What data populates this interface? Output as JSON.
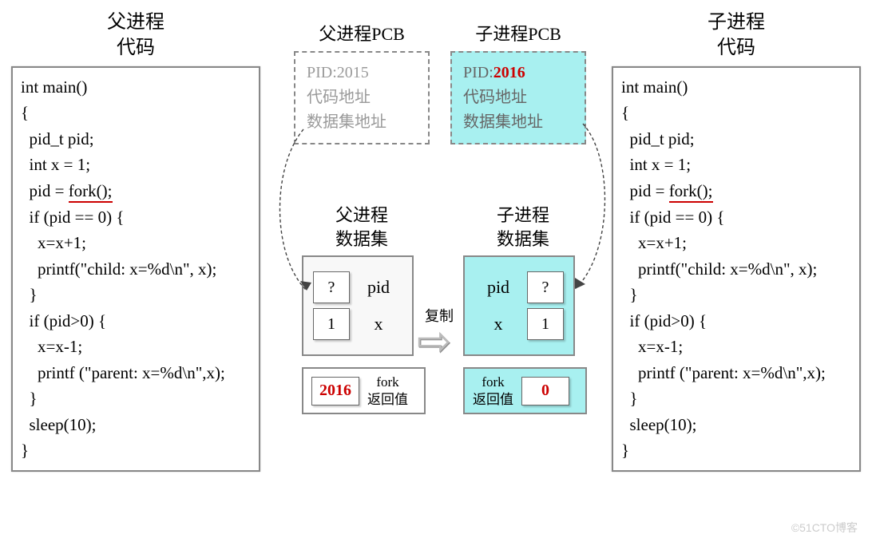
{
  "parent": {
    "title_l1": "父进程",
    "title_l2": "代码",
    "code": "int main()\n{\n  pid_t pid;\n  int x = 1;\n  pid = <u>fork();</u>\n  if (pid == 0) {\n    x=x+1;\n    printf(\"child: x=%d\\n\", x);\n  }\n  if (pid>0) {\n    x=x-1;\n    printf (\"parent: x=%d\\n\",x);\n  }\n  sleep(10);\n}"
  },
  "child": {
    "title_l1": "子进程",
    "title_l2": "代码",
    "code": "int main()\n{\n  pid_t pid;\n  int x = 1;\n  pid = <u>fork();</u>\n  if (pid == 0) {\n    x=x+1;\n    printf(\"child: x=%d\\n\", x);\n  }\n  if (pid>0) {\n    x=x-1;\n    printf (\"parent: x=%d\\n\",x);\n  }\n  sleep(10);\n}"
  },
  "pcb_parent": {
    "title": "父进程PCB",
    "pid_label": "PID:",
    "pid_value": "2015",
    "line2": "代码地址",
    "line3": "数据集地址"
  },
  "pcb_child": {
    "title": "子进程PCB",
    "pid_label": "PID:",
    "pid_value": "2016",
    "line2": "代码地址",
    "line3": "数据集地址"
  },
  "dataset_parent": {
    "title_l1": "父进程",
    "title_l2": "数据集",
    "pid_label": "pid",
    "pid_value": "?",
    "x_label": "x",
    "x_value": "1",
    "fork_label_l1": "fork",
    "fork_label_l2": "返回值",
    "fork_value": "2016"
  },
  "dataset_child": {
    "title_l1": "子进程",
    "title_l2": "数据集",
    "pid_label": "pid",
    "pid_value": "?",
    "x_label": "x",
    "x_value": "1",
    "fork_label_l1": "fork",
    "fork_label_l2": "返回值",
    "fork_value": "0"
  },
  "copy_label": "复制",
  "watermark": "©51CTO博客"
}
